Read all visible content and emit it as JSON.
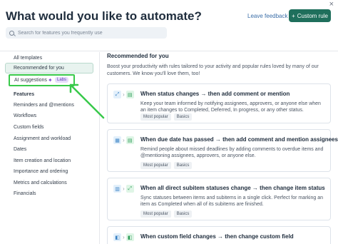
{
  "window": {
    "close_glyph": "×"
  },
  "header": {
    "title": "What would you like to automate?",
    "leave_feedback": "Leave feedback",
    "custom_rule": "Custom rule",
    "custom_rule_icon": "+",
    "search_placeholder": "Search for features you frequently use",
    "accent_color": "#1f6f5c"
  },
  "sidebar": {
    "all_templates": "All templates",
    "recommended": "Recommended for you",
    "ai_suggestions": "AI suggestions",
    "labs_badge": "Labs",
    "features_heading": "Features",
    "features": [
      "Reminders and @mentions",
      "Workflows",
      "Custom fields",
      "Assignment and workload",
      "Dates",
      "Item creation and location",
      "Importance and ordering",
      "Metrics and calculations",
      "Financials"
    ]
  },
  "content": {
    "title": "Recommended for you",
    "description": "Boost your productivity with rules tailored to your activity and popular rules loved by many of our customers. We know you'll love them, too!",
    "cards": [
      {
        "title": "When status changes → then add comment or mention",
        "description": "Keep your team informed by notifying assignees, approvers, or anyone else when an item changes to Completed, Deferred, In progress, or any other status.",
        "tags": [
          "Most popular",
          "Basics"
        ]
      },
      {
        "title": "When due date has passed → then add comment and mention assignees",
        "description": "Remind people about missed deadlines by adding comments to overdue items and @mentioning assignees, approvers, or anyone else.",
        "tags": [
          "Most popular",
          "Basics"
        ]
      },
      {
        "title": "When all direct subitem statuses change → then change item status",
        "description": "Sync statuses between items and subitems in a single click. Perfect for marking an item as Completed when all of its subitems are finished.",
        "tags": [
          "Most popular",
          "Basics"
        ]
      },
      {
        "title": "When custom field changes → then change custom field",
        "description": "",
        "tags": []
      }
    ]
  }
}
